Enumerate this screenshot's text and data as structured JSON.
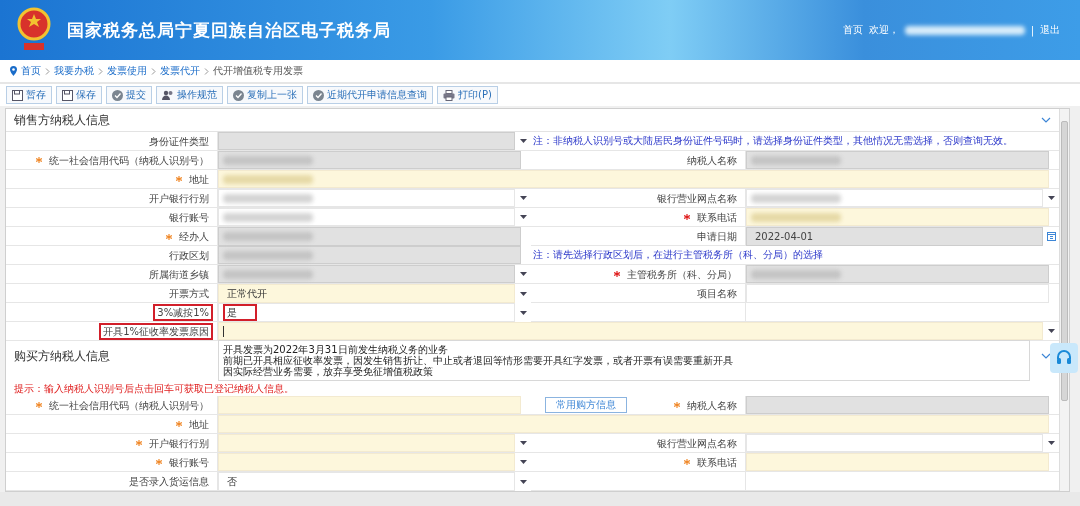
{
  "header": {
    "title": "国家税务总局宁夏回族自治区电子税务局",
    "home": "首页",
    "welcome": "欢迎，",
    "separator": "|",
    "logout": "退出"
  },
  "breadcrumb": [
    {
      "label": "首页",
      "link": true
    },
    {
      "label": "我要办税",
      "link": true
    },
    {
      "label": "发票使用",
      "link": true
    },
    {
      "label": "发票代开",
      "link": true
    },
    {
      "label": "代开增值税专用发票",
      "link": false
    }
  ],
  "toolbar": [
    {
      "label": "暂存",
      "kind": "disk"
    },
    {
      "label": "保存",
      "kind": "disk"
    },
    {
      "label": "提交",
      "kind": "check"
    },
    {
      "label": "操作规范",
      "kind": "people"
    },
    {
      "label": "复制上一张",
      "kind": "check"
    },
    {
      "label": "近期代开申请信息查询",
      "kind": "check"
    },
    {
      "label": "打印(P)",
      "kind": "printer"
    }
  ],
  "seller": {
    "title": "销售方纳税人信息",
    "expanded": true,
    "rows": [
      {
        "label": "身份证件类型",
        "required": false,
        "field": {
          "kind": "select",
          "disabled": true,
          "mandatory": false
        },
        "note": "注：非纳税人识别号或大陆居民身份证件号码时，请选择身份证件类型，其他情况无需选择，否则查询无效。"
      },
      {
        "label": "统一社会信用代码（纳税人识别号）",
        "required": true,
        "field": {
          "kind": "input",
          "disabled": true,
          "mandatory": false,
          "redacted": true
        },
        "right": {
          "label": "纳税人名称",
          "required": false,
          "field": {
            "kind": "input",
            "disabled": true,
            "mandatory": false,
            "redacted": true
          }
        }
      },
      {
        "label": "地址",
        "required": true,
        "full": true,
        "field": {
          "kind": "input",
          "disabled": false,
          "mandatory": true,
          "redacted": true
        }
      },
      {
        "label": "开户银行行别",
        "required": false,
        "field": {
          "kind": "select",
          "disabled": false,
          "mandatory": false,
          "redacted": true
        },
        "right": {
          "label": "银行营业网点名称",
          "required": false,
          "field": {
            "kind": "select",
            "disabled": false,
            "mandatory": false,
            "redacted": true
          }
        }
      },
      {
        "label": "银行账号",
        "required": false,
        "field": {
          "kind": "select",
          "disabled": false,
          "mandatory": false,
          "redacted": true
        },
        "right": {
          "label": "联系电话",
          "required": true,
          "field": {
            "kind": "input",
            "disabled": false,
            "mandatory": true,
            "redacted": true
          }
        }
      },
      {
        "label": "经办人",
        "required": true,
        "field": {
          "kind": "input",
          "disabled": true,
          "mandatory": false,
          "redacted": true
        },
        "right": {
          "label": "申请日期",
          "required": false,
          "field": {
            "kind": "date",
            "disabled": true,
            "mandatory": false,
            "value": "2022-04-01"
          }
        }
      },
      {
        "label": "行政区划",
        "required": false,
        "field": {
          "kind": "input",
          "disabled": true,
          "mandatory": false,
          "redacted": true
        },
        "note": "注：请先选择行政区划后，在进行主管税务所（科、分局）的选择"
      },
      {
        "label": "所属街道乡镇",
        "required": false,
        "field": {
          "kind": "select",
          "disabled": true,
          "mandatory": false,
          "redacted": true
        },
        "right": {
          "label": "主管税务所（科、分局）",
          "required": true,
          "field": {
            "kind": "input",
            "disabled": true,
            "mandatory": false,
            "redacted": true
          }
        }
      },
      {
        "label": "开票方式",
        "required": false,
        "field": {
          "kind": "select",
          "disabled": false,
          "mandatory": true,
          "value": "正常代开"
        },
        "right": {
          "label": "项目名称",
          "required": false,
          "field": {
            "kind": "input",
            "disabled": false,
            "mandatory": false
          }
        }
      },
      {
        "label": "3%减按1%",
        "required": false,
        "highlighted": true,
        "field": {
          "kind": "select",
          "disabled": false,
          "mandatory": false,
          "value": "是"
        }
      },
      {
        "label": "开具1%征收率发票原因",
        "required": false,
        "highlighted": true,
        "full": true,
        "focused": true,
        "field": {
          "kind": "select",
          "disabled": false,
          "mandatory": true
        }
      }
    ]
  },
  "reason_dropdown": {
    "options": [
      "开具发票为2022年3月31日前发生纳税义务的业务",
      "前期已开具相应征收率发票，因发生销售折让、中止或者退回等情形需要开具红字发票，或者开票有误需要重新开具",
      "因实际经营业务需要，放弃享受免征增值税政策"
    ]
  },
  "buyer": {
    "title": "购买方纳税人信息",
    "expanded": true,
    "hint": "提示：输入纳税人识别号后点击回车可获取已登记纳税人信息。",
    "rows": [
      {
        "label": "统一社会信用代码（纳税人识别号）",
        "required": true,
        "field": {
          "kind": "input",
          "disabled": false,
          "mandatory": true
        },
        "right": {
          "button": "常用购方信息",
          "label": "纳税人名称",
          "required": true,
          "field": {
            "kind": "input",
            "disabled": true,
            "mandatory": false
          }
        }
      },
      {
        "label": "地址",
        "required": true,
        "full": true,
        "field": {
          "kind": "input",
          "disabled": false,
          "mandatory": true
        }
      },
      {
        "label": "开户银行行别",
        "required": true,
        "field": {
          "kind": "select",
          "disabled": false,
          "mandatory": true
        },
        "right": {
          "label": "银行营业网点名称",
          "required": false,
          "field": {
            "kind": "select",
            "disabled": false,
            "mandatory": false
          }
        }
      },
      {
        "label": "银行账号",
        "required": true,
        "field": {
          "kind": "select",
          "disabled": false,
          "mandatory": true
        },
        "right": {
          "label": "联系电话",
          "required": true,
          "field": {
            "kind": "input",
            "disabled": false,
            "mandatory": true
          }
        }
      },
      {
        "label": "是否录入货运信息",
        "required": false,
        "field": {
          "kind": "select",
          "disabled": false,
          "mandatory": false,
          "value": "否"
        }
      }
    ]
  }
}
